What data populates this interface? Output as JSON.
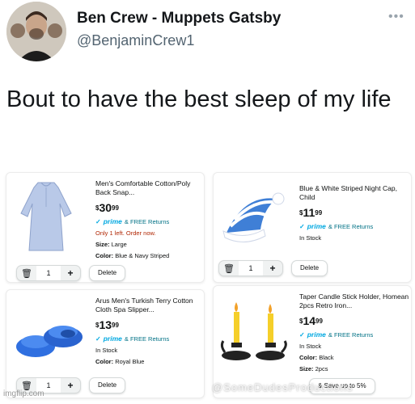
{
  "tweet": {
    "author_name": "Ben Crew - Muppets Gatsby",
    "author_handle": "@BenjaminCrew1",
    "more_icon": "more-horizontal-icon",
    "text": "Bout to have the best sleep of my life"
  },
  "cart": {
    "items": [
      {
        "title": "Men's Comfortable Cotton/Poly Back Snap...",
        "price_currency": "$",
        "price_whole": "30",
        "price_cents": "99",
        "prime_label": "prime",
        "prime_extra": "& FREE Returns",
        "stock": "Only 1 left. Order now.",
        "detail1_label": "Size:",
        "detail1_value": "Large",
        "detail2_label": "Color:",
        "detail2_value": "Blue & Navy Striped",
        "quantity": "1",
        "delete_label": "Delete"
      },
      {
        "title": "Blue & White Striped Night Cap, Child",
        "price_currency": "$",
        "price_whole": "11",
        "price_cents": "99",
        "prime_label": "prime",
        "prime_extra": "& FREE Returns",
        "stock": "In Stock",
        "quantity": "1",
        "delete_label": "Delete"
      },
      {
        "title": "Arus Men's Turkish Terry Cotton Cloth Spa Slipper...",
        "price_currency": "$",
        "price_whole": "13",
        "price_cents": "99",
        "prime_label": "prime",
        "prime_extra": "& FREE Returns",
        "stock": "In Stock",
        "detail1_label": "Color:",
        "detail1_value": "Royal Blue",
        "quantity": "1",
        "delete_label": "Delete"
      },
      {
        "title": "Taper Candle Stick Holder, Homean 2pcs Retro Iron...",
        "price_currency": "$",
        "price_whole": "14",
        "price_cents": "99",
        "prime_label": "prime",
        "prime_extra": "& FREE Returns",
        "stock": "In Stock",
        "detail1_label": "Color:",
        "detail1_value": "Black",
        "detail2_label": "Size:",
        "detail2_value": "2pcs",
        "save_label": "& Save up to 5%"
      }
    ]
  },
  "watermark": "imgflip.com",
  "overlay_mark": "@SomeDudesProductions"
}
